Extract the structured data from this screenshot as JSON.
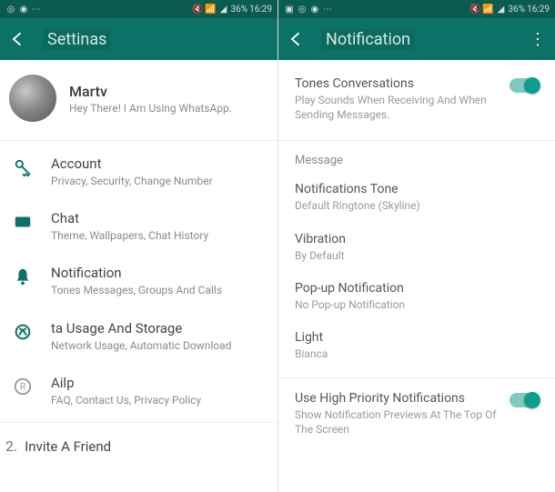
{
  "colors": {
    "primary": "#0c7267",
    "accent": "#0c9e8f"
  },
  "statusBar": {
    "battery": "36%",
    "time": "16:29"
  },
  "left": {
    "title": "Settinas",
    "profile": {
      "name": "Martv",
      "status": "Hey There! I Am Using WhatsApp."
    },
    "items": [
      {
        "icon": "key-icon",
        "title": "Account",
        "subtitle": "Privacy, Security, Change Number"
      },
      {
        "icon": "chat-icon",
        "title": "Chat",
        "subtitle": "Theme, Wallpapers, Chat History"
      },
      {
        "icon": "bell-icon",
        "title": "Notification",
        "subtitle": "Tones Messages, Groups And Calls"
      },
      {
        "icon": "data-icon",
        "title": "ta Usage And Storage",
        "subtitle": "Network Usage, Automatic Download"
      },
      {
        "icon": "help-icon",
        "title": "Ailp",
        "subtitle": "FAQ, Contact Us, Privacy Policy"
      }
    ],
    "invite": {
      "prefix": "2.",
      "label": "Invite A Friend"
    }
  },
  "right": {
    "title": "Notification",
    "tones": {
      "title": "Tones Conversations",
      "subtitle": "Play Sounds When Receiving And When Sending Messages."
    },
    "sectionMessage": "Message",
    "rows": [
      {
        "title": "Notifications Tone",
        "subtitle": "Default Ringtone (Skyline)"
      },
      {
        "title": "Vibration",
        "subtitle": "By Default"
      },
      {
        "title": "Pop-up Notification",
        "subtitle": "No Pop-up Notification"
      },
      {
        "title": "Light",
        "subtitle": "Bianca"
      }
    ],
    "highPriority": {
      "title": "Use High Priority Notifications",
      "subtitle": "Show Notification Previews At The Top Of The Screen"
    }
  }
}
